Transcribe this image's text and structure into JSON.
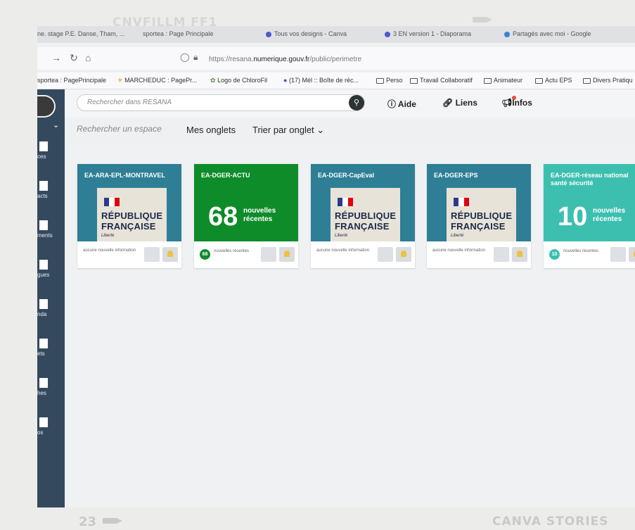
{
  "slide": {
    "title": "CNVFILLM FF1",
    "page_number": "23",
    "brand": "CANVA STORIES"
  },
  "browser": {
    "tabs": [
      "ne. stage P.E. Danse, Tham, ...",
      "sportea : Page Principale",
      "Tous vos designs - Canva",
      "3 EN version 1 - Diaporama",
      "Partagés avec moi - Google"
    ],
    "url_prefix": "https://resana.",
    "url_domain": "numerique.gouv.fr",
    "url_path": "/public/perimetre",
    "bookmarks": [
      "sportea : PagePrincipale",
      "MARCHEDUC : PagePr...",
      "Logo de ChloroFil",
      "(17) Mél :: Boîte de réc...",
      "Perso",
      "Travail Collaboratif",
      "Animateur",
      "Actu EPS",
      "Divers Pratiqu"
    ]
  },
  "sidebar": {
    "items": [
      "ces",
      "acts",
      "ments",
      "gues",
      "nda",
      "ets",
      "hes",
      "os"
    ]
  },
  "header": {
    "search_placeholder": "Rechercher dans RESANA",
    "aide": "Aide",
    "liens": "Liens",
    "infos": "Infos"
  },
  "filters": {
    "espace_placeholder": "Rechercher un espace",
    "onglets": "Mes onglets",
    "trier": "Trier par onglet"
  },
  "republique": {
    "line1": "RÉPUBLIQUE",
    "line2": "FRANÇAISE",
    "motto": "Liberté"
  },
  "cards": [
    {
      "title": "EA-ARA-EPL-MONTRAVEL",
      "color": "#2e7f96",
      "count": null,
      "footer": "aucune nouvelle information"
    },
    {
      "title": "EA-DGER-ACTU",
      "color": "#0e8c2a",
      "count": "68",
      "count_label": "nouvelles récentes",
      "footer_count": "68",
      "footer": "nouvelles récentes"
    },
    {
      "title": "EA-DGER-CapEval",
      "color": "#2e7f96",
      "count": null,
      "footer": "aucune nouvelle information"
    },
    {
      "title": "EA-DGER-EPS",
      "color": "#2e7f96",
      "count": null,
      "footer": "aucune nouvelle information"
    },
    {
      "title": "EA-DGER-réseau national santé sécurité",
      "color": "#3dbfb0",
      "count": "10",
      "count_label": "nouvelles récentes",
      "footer_count": "10",
      "footer": "nouvelles récentes"
    }
  ],
  "icons": [
    "back-arrow-icon",
    "forward-arrow-icon",
    "reload-icon",
    "home-icon",
    "shield-icon",
    "lock-icon",
    "search-icon",
    "help-icon",
    "link-icon",
    "megaphone-icon",
    "folder-icon",
    "list-icon",
    "bell-icon",
    "chevron-down-icon"
  ]
}
